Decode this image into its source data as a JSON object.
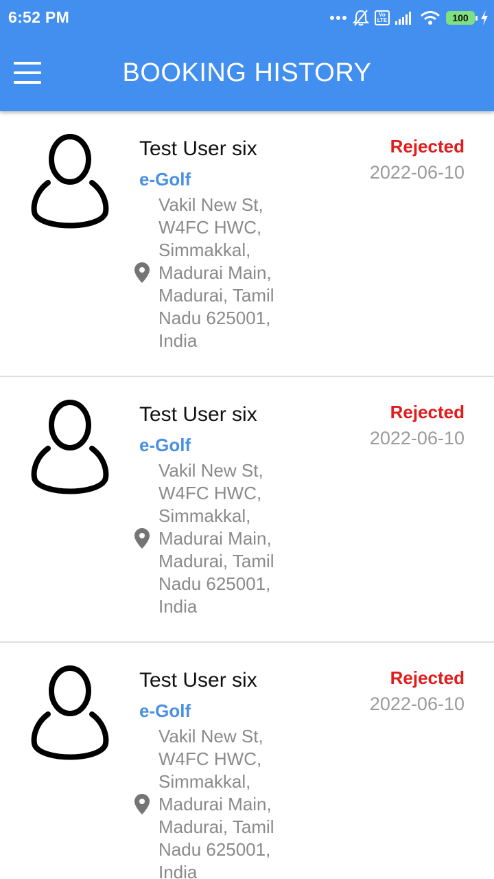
{
  "status_bar": {
    "time": "6:52 PM",
    "volte": "Vo LTE",
    "battery": "100",
    "icons": [
      "more-dots-icon",
      "bell-muted-icon",
      "volte-icon",
      "signal-icon",
      "wifi-icon",
      "battery-icon",
      "charging-icon"
    ]
  },
  "app_bar": {
    "title": "BOOKING HISTORY",
    "menu_icon": "hamburger-menu-icon"
  },
  "colors": {
    "primary": "#428ff0",
    "car_name": "#4a90e2",
    "status_rejected": "#e21b1b",
    "secondary_text": "#8a8a8a"
  },
  "bookings": [
    {
      "user": "Test User six",
      "car": "e-Golf",
      "address": [
        "Vakil New St,",
        "W4FC HWC,",
        "Simmakkal,",
        "Madurai Main,",
        "Madurai, Tamil",
        "Nadu 625001,",
        "India"
      ],
      "status": "Rejected",
      "date": "2022-06-10",
      "avatar_icon": "user-avatar-icon",
      "location_icon": "location-pin-icon"
    },
    {
      "user": "Test User six",
      "car": "e-Golf",
      "address": [
        "Vakil New St,",
        "W4FC HWC,",
        "Simmakkal,",
        "Madurai Main,",
        "Madurai, Tamil",
        "Nadu 625001,",
        "India"
      ],
      "status": "Rejected",
      "date": "2022-06-10",
      "avatar_icon": "user-avatar-icon",
      "location_icon": "location-pin-icon"
    },
    {
      "user": "Test User six",
      "car": "e-Golf",
      "address": [
        "Vakil New St,",
        "W4FC HWC,",
        "Simmakkal,",
        "Madurai Main,",
        "Madurai, Tamil",
        "Nadu 625001,",
        "India"
      ],
      "status": "Rejected",
      "date": "2022-06-10",
      "avatar_icon": "user-avatar-icon",
      "location_icon": "location-pin-icon"
    }
  ]
}
